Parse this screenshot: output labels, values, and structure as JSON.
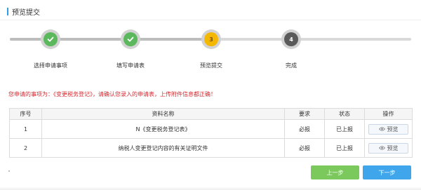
{
  "header": {
    "title": "预览提交"
  },
  "steps": [
    {
      "label": "选择申请事项",
      "status": "done",
      "number": "1"
    },
    {
      "label": "填写申请表",
      "status": "done",
      "number": "2"
    },
    {
      "label": "预览提交",
      "status": "current",
      "number": "3"
    },
    {
      "label": "完成",
      "status": "pending",
      "number": "4"
    }
  ],
  "notice": "您申请的事项为：《变更税务登记》，请确认您录入的申请表，上传附件信息都正确！",
  "table": {
    "headers": [
      "序号",
      "资料名称",
      "要求",
      "状态",
      "操作"
    ],
    "rows": [
      {
        "index": "1",
        "name": "N《变更税务登记表》",
        "requirement": "必报",
        "status": "已上报",
        "action": "预览"
      },
      {
        "index": "2",
        "name": "纳税人变更登记内容的有关证明文件",
        "requirement": "必报",
        "status": "已上报",
        "action": "预览"
      }
    ]
  },
  "buttons": {
    "prev": "上一步",
    "next": "下一步"
  },
  "colors": {
    "accent": "#2f9de2",
    "done": "#5cb85c",
    "current": "#f5b800",
    "pending": "#5b5b5b",
    "warning": "#d8272e",
    "prev": "#7bc85d",
    "next": "#3fa6ec"
  }
}
